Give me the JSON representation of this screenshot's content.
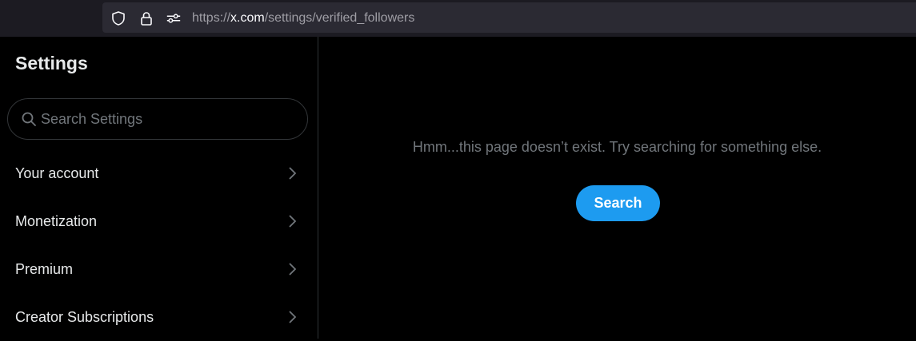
{
  "browser": {
    "url_prefix": "https://",
    "url_host": "x.com",
    "url_path": "/settings/verified_followers",
    "icons": [
      "shield-icon",
      "lock-icon",
      "permissions-icon"
    ]
  },
  "sidebar": {
    "title": "Settings",
    "search_placeholder": "Search Settings",
    "items": [
      {
        "label": "Your account"
      },
      {
        "label": "Monetization"
      },
      {
        "label": "Premium"
      },
      {
        "label": "Creator Subscriptions"
      }
    ]
  },
  "main": {
    "empty_message": "Hmm...this page doesn’t exist. Try searching for something else.",
    "search_button": "Search"
  },
  "colors": {
    "accent": "#1d9bf0",
    "text_primary": "#e7e9ea",
    "text_secondary": "#71767b",
    "background": "#000000",
    "border": "#2f3336"
  }
}
